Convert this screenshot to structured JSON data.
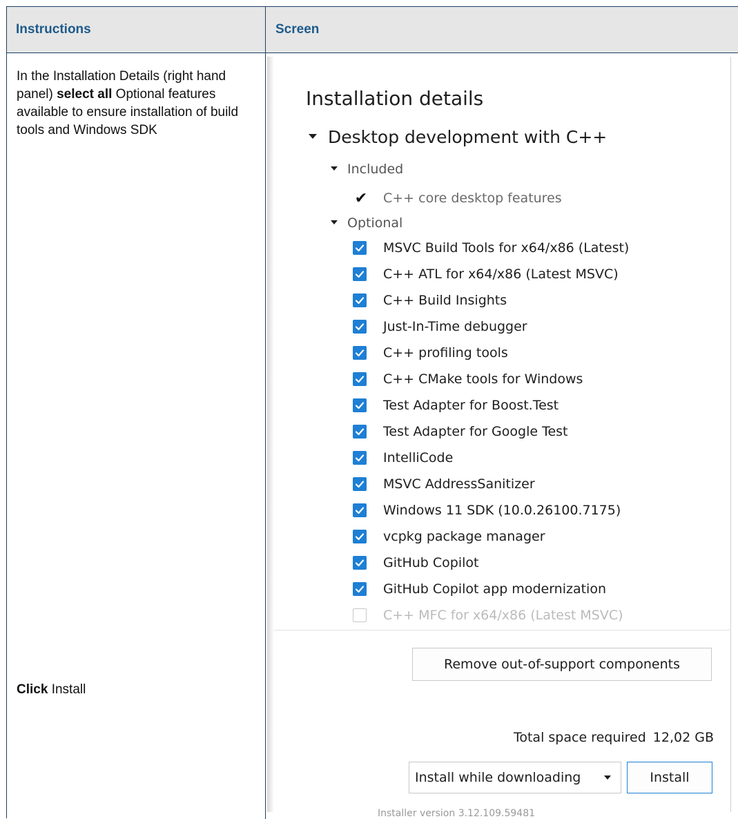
{
  "table": {
    "header_instructions": "Instructions",
    "header_screen": "Screen"
  },
  "instructions": {
    "step1_prefix": "In the Installation Details (right hand panel) ",
    "step1_bold": "select all",
    "step1_suffix": " Optional features available to ensure installation of build tools and Windows SDK",
    "step2_bold": "Click",
    "step2_suffix": " Install"
  },
  "screen": {
    "panel_title": "Installation details",
    "workload": "Desktop development with C++",
    "included_label": "Included",
    "included_items": [
      "C++ core desktop features"
    ],
    "optional_label": "Optional",
    "optional_items": [
      {
        "label": "MSVC Build Tools for x64/x86 (Latest)",
        "checked": true
      },
      {
        "label": "C++ ATL for x64/x86 (Latest MSVC)",
        "checked": true
      },
      {
        "label": "C++ Build Insights",
        "checked": true
      },
      {
        "label": "Just-In-Time debugger",
        "checked": true
      },
      {
        "label": "C++ profiling tools",
        "checked": true
      },
      {
        "label": "C++ CMake tools for Windows",
        "checked": true
      },
      {
        "label": "Test Adapter for Boost.Test",
        "checked": true
      },
      {
        "label": "Test Adapter for Google Test",
        "checked": true
      },
      {
        "label": "IntelliCode",
        "checked": true
      },
      {
        "label": "MSVC AddressSanitizer",
        "checked": true
      },
      {
        "label": "Windows 11 SDK (10.0.26100.7175)",
        "checked": true
      },
      {
        "label": "vcpkg package manager",
        "checked": true
      },
      {
        "label": "GitHub Copilot",
        "checked": true
      },
      {
        "label": "GitHub Copilot app modernization",
        "checked": true
      },
      {
        "label": "C++ MFC for x64/x86 (Latest MSVC)",
        "checked": false
      }
    ],
    "remove_button": "Remove out-of-support components",
    "space_label": "Total space required",
    "space_value": "12,02 GB",
    "install_mode": "Install while downloading",
    "install_button": "Install",
    "footer_partial": "Installer version 3.12.109.59481"
  },
  "colors": {
    "header_text": "#1d5b8c",
    "header_bg": "#e6e6e6",
    "checkbox": "#1e7fd4"
  }
}
